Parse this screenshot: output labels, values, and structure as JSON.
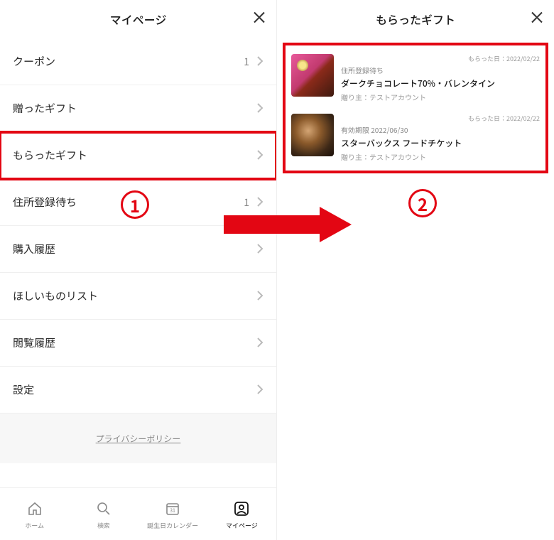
{
  "left": {
    "title": "マイページ",
    "rows": [
      {
        "label": "クーポン",
        "count": "1"
      },
      {
        "label": "贈ったギフト",
        "count": ""
      },
      {
        "label": "もらったギフト",
        "count": "",
        "highlight": true
      },
      {
        "label": "住所登録待ち",
        "count": "1"
      },
      {
        "label": "購入履歴",
        "count": ""
      },
      {
        "label": "ほしいものリスト",
        "count": ""
      },
      {
        "label": "閲覧履歴",
        "count": ""
      },
      {
        "label": "設定",
        "count": ""
      }
    ],
    "privacy": "プライバシーポリシー",
    "tabs": [
      {
        "label": "ホーム"
      },
      {
        "label": "検索"
      },
      {
        "label": "誕生日カレンダー"
      },
      {
        "label": "マイページ",
        "active": true
      }
    ]
  },
  "right": {
    "title": "もらったギフト",
    "gifts": [
      {
        "date": "もらった日：2022/02/22",
        "status": "住所登録待ち",
        "name": "ダークチョコレート70%・バレンタイン",
        "sender": "贈り主：テストアカウント"
      },
      {
        "date": "もらった日：2022/02/22",
        "status": "有効期限 2022/06/30",
        "name": "スターバックス フードチケット",
        "sender": "贈り主：テストアカウント"
      }
    ]
  },
  "annotations": {
    "step1": "1",
    "step2": "2"
  },
  "colors": {
    "accent": "#e30613"
  }
}
